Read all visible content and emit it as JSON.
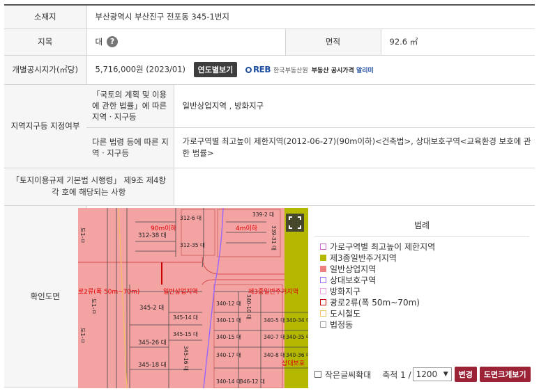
{
  "rows": {
    "address": {
      "label": "소재지",
      "value": "부산광역시 부산진구 전포동 345-1번지"
    },
    "jimok": {
      "label": "지목",
      "value": "대",
      "help": "?"
    },
    "area": {
      "label": "면적",
      "value": "92.6 ㎡"
    },
    "price": {
      "label": "개별공시지가(㎡당)",
      "value": "5,716,000원 (2023/01)",
      "btn": "연도별보기",
      "reb_logo": "REB",
      "reb_org": "한국부동산원",
      "reb_alarm_prefix": "부동산 공시가격",
      "reb_alarm_suffix": "알리미"
    },
    "zone": {
      "label": "지역지구등 지정여부",
      "sub1_label": "「국토의 계획 및 이용에 관한 법률」에 따른 지역ㆍ지구등",
      "sub1_value": "일반상업지역 , 방화지구",
      "sub2_label": "다른 법령 등에 따른 지역ㆍ지구등",
      "sub2_value": "가로구역별 최고높이 제한지역(2012-06-27)(90m이하)<건축법>, 상대보호구역<교육환경 보호에 관한 법률>"
    },
    "enforce": {
      "label": "「토지이용규제 기본법 시행령」 제9조 제4항 각 호에 해당되는 사항",
      "value": ""
    },
    "map": {
      "label": "확인도면"
    }
  },
  "map_labels": {
    "parcels": [
      "312-6 대",
      "312-38 대",
      "312-35 대",
      "339-2 대",
      "339-31 대",
      "345-2 대",
      "345-14 대",
      "345-15 대",
      "345-26 대",
      "345-18 대",
      "345-16 대",
      "340-12 대",
      "340-10 대",
      "340-15 대",
      "340-7 대",
      "340-17 대",
      "340-8 대",
      "340-11 대",
      "340-5 대",
      "340-34 대",
      "340-35 대",
      "340-36 대",
      "346-12 대",
      "340-14 대"
    ],
    "red": [
      "90m이하",
      "4m이하",
      "로2류(폭 50m~70m)",
      "일반상업지역",
      "제3종일반주거지역",
      "상대보호"
    ],
    "road": [
      "도1-ㅁ",
      "도1-ㅁ",
      "도1-ㅁ"
    ]
  },
  "legend": {
    "title": "범례",
    "items": [
      {
        "label": "가로구역별 최고높이 제한지역",
        "color": "#cc66cc",
        "style": "outline"
      },
      {
        "label": "제3종일반주거지역",
        "color": "#b5b800",
        "style": "fill"
      },
      {
        "label": "일반상업지역",
        "color": "#f08080",
        "style": "fill"
      },
      {
        "label": "상대보호구역",
        "color": "#9966ff",
        "style": "outline"
      },
      {
        "label": "방화지구",
        "color": "#ee99ee",
        "style": "outline"
      },
      {
        "label": "광로2류(폭 50m~70m)",
        "color": "#cc0000",
        "style": "outline"
      },
      {
        "label": "도시철도",
        "color": "#f0c060",
        "style": "outline"
      },
      {
        "label": "법정동",
        "color": "#999999",
        "style": "outline"
      }
    ],
    "zoom_label": "작은글씨확대",
    "scale_label": "축척 1 /",
    "scale_value": "1200",
    "change_btn": "변경",
    "enlarge_btn": "도면크게보기"
  },
  "colors": {
    "commercial": "#f4a3a3",
    "residential": "#b5b800",
    "btn_red": "#9b2335"
  }
}
